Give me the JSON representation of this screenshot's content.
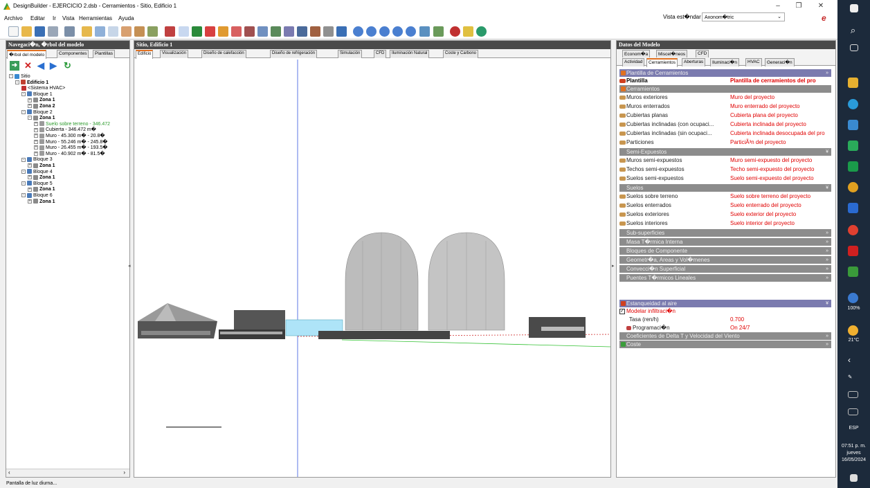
{
  "window": {
    "title": "DesignBuilder - EJERCICIO 2.dsb - Cerramientos - Sitio, Edificio 1",
    "min": "–",
    "max": "❐",
    "close": "✕"
  },
  "menu": [
    "Archivo",
    "Editar",
    "Ir",
    "Vista",
    "Herramientas",
    "Ayuda"
  ],
  "view_selector": {
    "label": "Vista est�ndar",
    "value": "Axonom�tric"
  },
  "nav": {
    "header": "Navegaci�n, �rbol del modelo",
    "tabs": [
      "�rbol del modelo",
      "Componentes",
      "Plantillas"
    ],
    "tree": [
      {
        "t": "Sitio",
        "d": 0,
        "pm": "-",
        "ic": "site"
      },
      {
        "t": "Edificio 1",
        "d": 1,
        "pm": "-",
        "ic": "building",
        "b": true
      },
      {
        "t": "<Sistema HVAC>",
        "d": 2,
        "pm": "",
        "ic": "hvac"
      },
      {
        "t": "Bloque 1",
        "d": 2,
        "pm": "-",
        "ic": "block"
      },
      {
        "t": "Zona 1",
        "d": 3,
        "pm": "+",
        "ic": "zone",
        "b": true
      },
      {
        "t": "Zona 2",
        "d": 3,
        "pm": "+",
        "ic": "zone",
        "b": true
      },
      {
        "t": "Bloque 2",
        "d": 2,
        "pm": "-",
        "ic": "block"
      },
      {
        "t": "Zona 1",
        "d": 3,
        "pm": "-",
        "ic": "zone",
        "b": true
      },
      {
        "t": "Suelo sobre terreno - 346.472",
        "d": 4,
        "pm": "+",
        "ic": "surf",
        "green": true
      },
      {
        "t": "Cubierta - 346.472 m�",
        "d": 4,
        "pm": "+",
        "ic": "surf"
      },
      {
        "t": "Muro - 45.300 m� - 20.8�",
        "d": 4,
        "pm": "+",
        "ic": "surf"
      },
      {
        "t": "Muro - 55.246 m� - 245.8�",
        "d": 4,
        "pm": "+",
        "ic": "surf"
      },
      {
        "t": "Muro - 26.455 m� - 193.5�",
        "d": 4,
        "pm": "+",
        "ic": "surf"
      },
      {
        "t": "Muro - 40.902 m� - 81.5�",
        "d": 4,
        "pm": "+",
        "ic": "surf"
      },
      {
        "t": "Bloque 3",
        "d": 2,
        "pm": "-",
        "ic": "block"
      },
      {
        "t": "Zona 1",
        "d": 3,
        "pm": "+",
        "ic": "zone",
        "b": true
      },
      {
        "t": "Bloque 4",
        "d": 2,
        "pm": "-",
        "ic": "block"
      },
      {
        "t": "Zona 1",
        "d": 3,
        "pm": "+",
        "ic": "zone",
        "b": true
      },
      {
        "t": "Bloque 5",
        "d": 2,
        "pm": "-",
        "ic": "block"
      },
      {
        "t": "Zona 1",
        "d": 3,
        "pm": "+",
        "ic": "zone",
        "b": true
      },
      {
        "t": "Bloque 6",
        "d": 2,
        "pm": "-",
        "ic": "block"
      },
      {
        "t": "Zona 1",
        "d": 3,
        "pm": "+",
        "ic": "zone",
        "b": true
      }
    ]
  },
  "view": {
    "header": "Sitio, Edificio 1",
    "tabs": [
      "Edificio",
      "Visualización",
      "Diseño de calefacción",
      "Diseño de refrigeración",
      "Simulación",
      "CFD",
      "Iluminación Natural",
      "Coste y Carbono"
    ]
  },
  "data": {
    "header": "Datos del Modelo",
    "tabs_row1": [
      "Econom�a",
      "Miscel�neos",
      "CFD"
    ],
    "tabs_row2": [
      "Actividad",
      "Cerramientos",
      "Aberturas",
      "Iluminaci�n",
      "HVAC",
      "Generaci�n"
    ],
    "plantilla_sec": "Plantilla de Cerramientos",
    "plantilla_label": "Plantilla",
    "plantilla_value": "Plantilla de cerramientos del pro",
    "cerr_sec": "Cerramientos",
    "cerr": [
      {
        "l": "Muros exteriores",
        "v": "Muro del proyecto"
      },
      {
        "l": "Muros enterrados",
        "v": "Muro enterrado del proyecto"
      },
      {
        "l": "Cubiertas planas",
        "v": "Cubierta plana del proyecto"
      },
      {
        "l": "Cubiertas inclinadas (con ocupaci...",
        "v": "Cubierta inclinada del proyecto"
      },
      {
        "l": "Cubiertas inclinadas (sin ocupaci...",
        "v": "Cubierta inclinada desocupada del pro"
      },
      {
        "l": "Particiones",
        "v": "ParticiÃ³n del proyecto"
      }
    ],
    "semi_sec": "Semi-Expuestos",
    "semi": [
      {
        "l": "Muros semi-expuestos",
        "v": "Muro semi-expuesto del proyecto"
      },
      {
        "l": "Techos semi-expuestos",
        "v": "Techo semi-expuesto del proyecto"
      },
      {
        "l": "Suelos semi-expuestos",
        "v": "Suelo semi-expuesto del proyecto"
      }
    ],
    "suelos_sec": "Suelos",
    "suelos": [
      {
        "l": "Suelos sobre terreno",
        "v": "Suelo sobre terreno del proyecto"
      },
      {
        "l": "Suelos enterrados",
        "v": "Suelo enterrado del proyecto"
      },
      {
        "l": "Suelos exteriores",
        "v": "Suelo exterior del proyecto"
      },
      {
        "l": "Suelos interiores",
        "v": "Suelo interior del proyecto"
      }
    ],
    "collapsed": [
      "Sub-superficies",
      "Masa T�rmica Interna",
      "Bloques de Componente",
      "Geometr�a, Areas y Vol�menes",
      "Convecci�n Superficial",
      "Puentes T�rmicos Lineales"
    ],
    "estanq_sec": "Estanqueidad al aire",
    "modelar": "Modelar infiltraci�n",
    "tasa_label": "Tasa (ren/h)",
    "tasa_value": "0.700",
    "prog_label": "Programaci�n",
    "prog_value": "On 24/7",
    "coef": "Coeficientes de Delta T y Velocidad del Viento",
    "coste": "Coste"
  },
  "status": "Pantalla de luz diurna...",
  "taskbar": {
    "battery": "100%",
    "temp": "21°C",
    "lang": "ESP",
    "time": "07:51 p. m.",
    "day": "jueves",
    "date": "16/05/2024"
  }
}
